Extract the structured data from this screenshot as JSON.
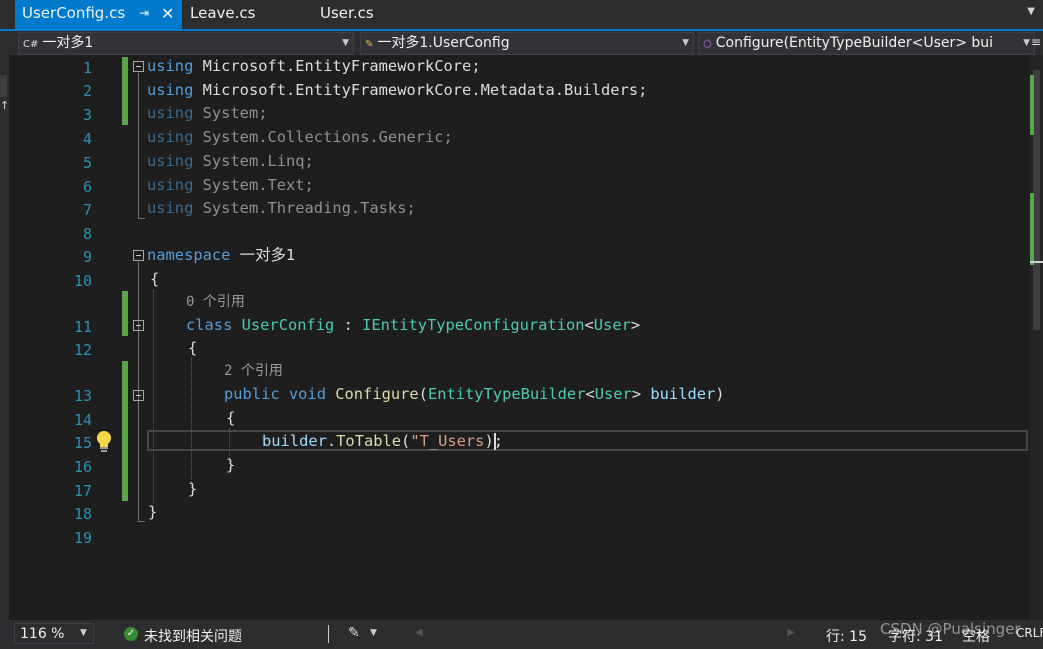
{
  "tabs": [
    {
      "label": "UserConfig.cs",
      "active": true,
      "pin": "⇥",
      "close": "✕"
    },
    {
      "label": "Leave.cs"
    },
    {
      "label": "User.cs"
    }
  ],
  "nav": {
    "project": "一对多1",
    "class": "一对多1.UserConfig",
    "member": "Configure(EntityTypeBuilder<User> bui"
  },
  "line_numbers": [
    "1",
    "2",
    "3",
    "4",
    "5",
    "6",
    "7",
    "8",
    "9",
    "10",
    "11",
    "12",
    "13",
    "14",
    "15",
    "16",
    "17",
    "18",
    "19"
  ],
  "code": {
    "l1": {
      "kw": "using",
      "rest": " Microsoft.EntityFrameworkCore;"
    },
    "l2": {
      "kw": "using",
      "rest": " Microsoft.EntityFrameworkCore.Metadata.Builders;"
    },
    "l3": {
      "kw": "using",
      "rest": " System;"
    },
    "l4": {
      "kw": "using",
      "rest": " System.Collections.Generic;"
    },
    "l5": {
      "kw": "using",
      "rest": " System.Linq;"
    },
    "l6": {
      "kw": "using",
      "rest": " System.Text;"
    },
    "l7": {
      "kw": "using",
      "rest": " System.Threading.Tasks;"
    },
    "l9": {
      "kw": "namespace",
      "rest": " 一对多1"
    },
    "l10": "{",
    "lens1": "0 个引用",
    "l11": {
      "kw": "class",
      "name": "UserConfig",
      "sep": " : ",
      "iface": "IEntityTypeConfiguration",
      "lt": "<",
      "arg": "User",
      "gt": ">"
    },
    "l12": "{",
    "lens2": "2 个引用",
    "l13": {
      "kw1": "public",
      "kw2": "void",
      "method": "Configure",
      "open": "(",
      "ptype": "EntityTypeBuilder",
      "lt": "<",
      "arg": "User",
      "gt": ">",
      "pname": "builder",
      "close": ")"
    },
    "l14": "{",
    "l15": {
      "obj": "builder",
      "dot": ".",
      "method": "ToTable",
      "open": "(",
      "str": "\"T_Users",
      "close": ");"
    },
    "l16": "}",
    "l17": "}",
    "l18": "}"
  },
  "status": {
    "zoom": "116 %",
    "issues": "未找到相关问题",
    "line": "行: 15",
    "col": "字符: 31",
    "space": "空格",
    "eol": "CRLF"
  },
  "watermark": "CSDN @Pualsinger"
}
